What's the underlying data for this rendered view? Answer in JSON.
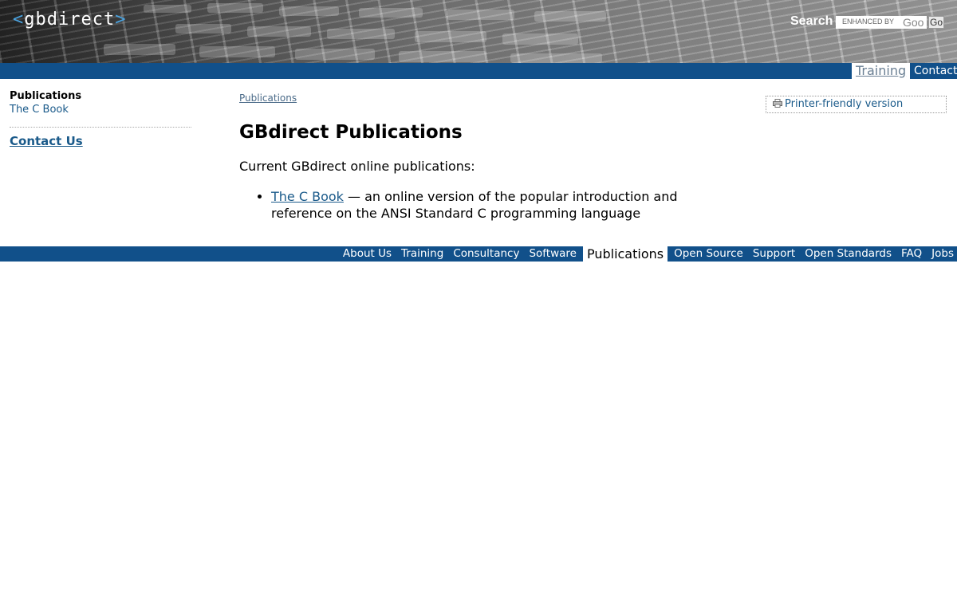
{
  "header": {
    "logo_open": "<",
    "logo_text": "gbdirect",
    "logo_close": ">",
    "search_label": "Search",
    "search_placeholder": "ENHANCED BY",
    "search_brand": "Goo",
    "go_label": "Go"
  },
  "top_nav": {
    "training": "Training",
    "contact": "Contact"
  },
  "sidebar": {
    "section_title": "Publications",
    "section_items": [
      "The C Book"
    ],
    "contact_link": "Contact Us"
  },
  "main": {
    "breadcrumb": "Publications",
    "printer_friendly": "Printer-friendly version",
    "title": "GBdirect Publications",
    "intro": "Current GBdirect online publications:",
    "publications": [
      {
        "link": "The C Book",
        "description": " — an online version of the popular introduction and reference on the ANSI Standard C programming language"
      }
    ]
  },
  "footer_nav": {
    "items": [
      "About Us",
      "Training",
      "Consultancy",
      "Software",
      "Publications",
      "Open Source",
      "Support",
      "Open Standards",
      "FAQ",
      "Jobs"
    ],
    "active": "Publications"
  },
  "colors": {
    "nav_bar": "#11508a",
    "link": "#1a5a8a"
  }
}
